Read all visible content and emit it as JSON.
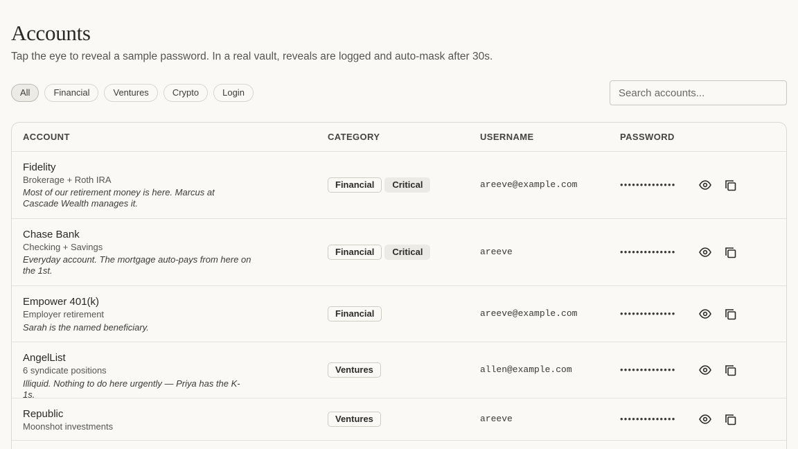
{
  "header": {
    "title": "Accounts",
    "subtitle": "Tap the eye to reveal a sample password. In a real vault, reveals are logged and auto-mask after 30s."
  },
  "filters": [
    "All",
    "Financial",
    "Ventures",
    "Crypto",
    "Login"
  ],
  "active_filter": "All",
  "search": {
    "placeholder": "Search accounts..."
  },
  "table": {
    "columns": [
      "ACCOUNT",
      "CATEGORY",
      "USERNAME",
      "PASSWORD"
    ],
    "rows": [
      {
        "name": "Fidelity",
        "subtitle": "Brokerage + Roth IRA",
        "note": "Most of our retirement money is here. Marcus at Cascade Wealth manages it.",
        "tags": [
          "Financial",
          "Critical"
        ],
        "username": "areeve@example.com",
        "password_mask": "••••••••••••••"
      },
      {
        "name": "Chase Bank",
        "subtitle": "Checking + Savings",
        "note": "Everyday account. The mortgage auto-pays from here on the 1st.",
        "tags": [
          "Financial",
          "Critical"
        ],
        "username": "areeve",
        "password_mask": "••••••••••••••"
      },
      {
        "name": "Empower 401(k)",
        "subtitle": "Employer retirement",
        "note": "Sarah is the named beneficiary.",
        "tags": [
          "Financial"
        ],
        "username": "areeve@example.com",
        "password_mask": "••••••••••••••"
      },
      {
        "name": "AngelList",
        "subtitle": "6 syndicate positions",
        "note": "Illiquid. Nothing to do here urgently — Priya has the K-1s.",
        "tags": [
          "Ventures"
        ],
        "username": "allen@example.com",
        "password_mask": "••••••••••••••"
      },
      {
        "name": "Republic",
        "subtitle": "Moonshot investments",
        "note": "",
        "tags": [
          "Ventures"
        ],
        "username": "areeve",
        "password_mask": "••••••••••••••"
      }
    ]
  },
  "icons": {
    "reveal": "eye-icon",
    "copy": "copy-icon"
  },
  "colors": {
    "background": "#faf9f6",
    "border": "#dcd9d2",
    "critical_tag_bg": "#eceae5"
  }
}
